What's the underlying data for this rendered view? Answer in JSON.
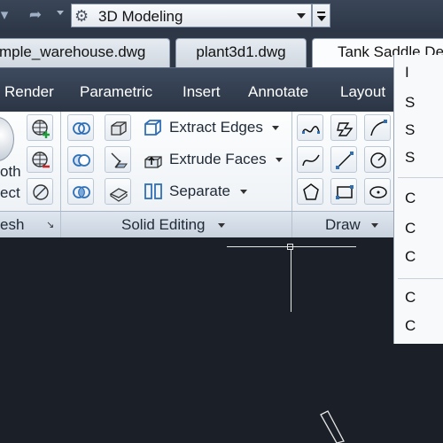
{
  "quick_access": {
    "redo_icon": "redo-arrow-icon",
    "workspace": {
      "icon": "gear-icon",
      "label": "3D Modeling"
    }
  },
  "document_tabs": [
    {
      "label": "mple_warehouse.dwg"
    },
    {
      "label": "plant3d1.dwg"
    },
    {
      "label": "Tank Saddle De",
      "active": true
    }
  ],
  "ribbon_tabs": [
    {
      "label": "Render"
    },
    {
      "label": "Parametric"
    },
    {
      "label": "Insert"
    },
    {
      "label": "Annotate"
    },
    {
      "label": "Layout"
    }
  ],
  "mesh_panel": {
    "label": "esh",
    "smooth_text_top": "oth",
    "smooth_text_bottom": "ect"
  },
  "solid_editing": {
    "label": "Solid Editing",
    "commands": [
      {
        "label": "Extract Edges"
      },
      {
        "label": "Extrude Faces"
      },
      {
        "label": "Separate"
      }
    ]
  },
  "draw_panel": {
    "label": "Draw"
  },
  "context_menu": {
    "items": [
      "I",
      "S",
      "S",
      "S",
      "C",
      "C",
      "C",
      "C",
      "C"
    ]
  },
  "colors": {
    "canvas": "#1b1f27",
    "ribbon_bar": "#2b3544",
    "accent_blue": "#2f6fb6"
  }
}
